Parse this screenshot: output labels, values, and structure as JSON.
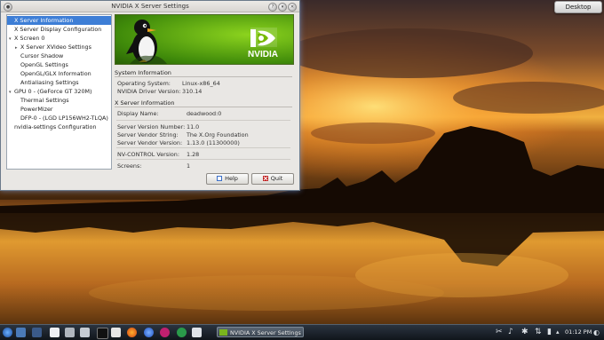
{
  "desktop": {
    "widget_label": "Desktop"
  },
  "window": {
    "title": "NVIDIA X Server Settings",
    "tree": [
      {
        "label": "X Server Information",
        "level": 0,
        "selected": true
      },
      {
        "label": "X Server Display Configuration",
        "level": 0
      },
      {
        "label": "X Screen 0",
        "level": 0,
        "expander": true
      },
      {
        "label": "X Server XVideo Settings",
        "level": 1,
        "expander": true
      },
      {
        "label": "Cursor Shadow",
        "level": 1
      },
      {
        "label": "OpenGL Settings",
        "level": 1
      },
      {
        "label": "OpenGL/GLX Information",
        "level": 1
      },
      {
        "label": "Antialiasing Settings",
        "level": 1
      },
      {
        "label": "GPU 0 - (GeForce GT 320M)",
        "level": 0,
        "expander": true
      },
      {
        "label": "Thermal Settings",
        "level": 1
      },
      {
        "label": "PowerMizer",
        "level": 1
      },
      {
        "label": "DFP-0 - (LGD LP156WH2-TLQA)",
        "level": 1
      },
      {
        "label": "nvidia-settings Configuration",
        "level": 0
      }
    ],
    "banner": {
      "logo_text": "NVIDIA"
    },
    "system_info": {
      "title": "System Information",
      "os_label": "Operating System:",
      "os_value": "Linux-x86_64",
      "driver_label": "NVIDIA Driver Version:",
      "driver_value": "310.14"
    },
    "xserver_info": {
      "title": "X Server Information",
      "display_label": "Display Name:",
      "display_value": "deadwood:0",
      "version_label": "Server Version Number:",
      "version_value": "11.0",
      "vendor_label": "Server Vendor String:",
      "vendor_value": "The X.Org Foundation",
      "vendor_version_label": "Server Vendor Version:",
      "vendor_version_value": "1.13.0 (11300000)",
      "nvcontrol_label": "NV-CONTROL Version:",
      "nvcontrol_value": "1.28",
      "screens_label": "Screens:",
      "screens_value": "1"
    },
    "buttons": {
      "help": "Help",
      "quit": "Quit"
    }
  },
  "taskbar": {
    "task_label": "NVIDIA X Server Settings",
    "clock": "01:12 PM",
    "colors": {
      "accent": "#76b900",
      "selection": "#3d7ed6"
    }
  }
}
